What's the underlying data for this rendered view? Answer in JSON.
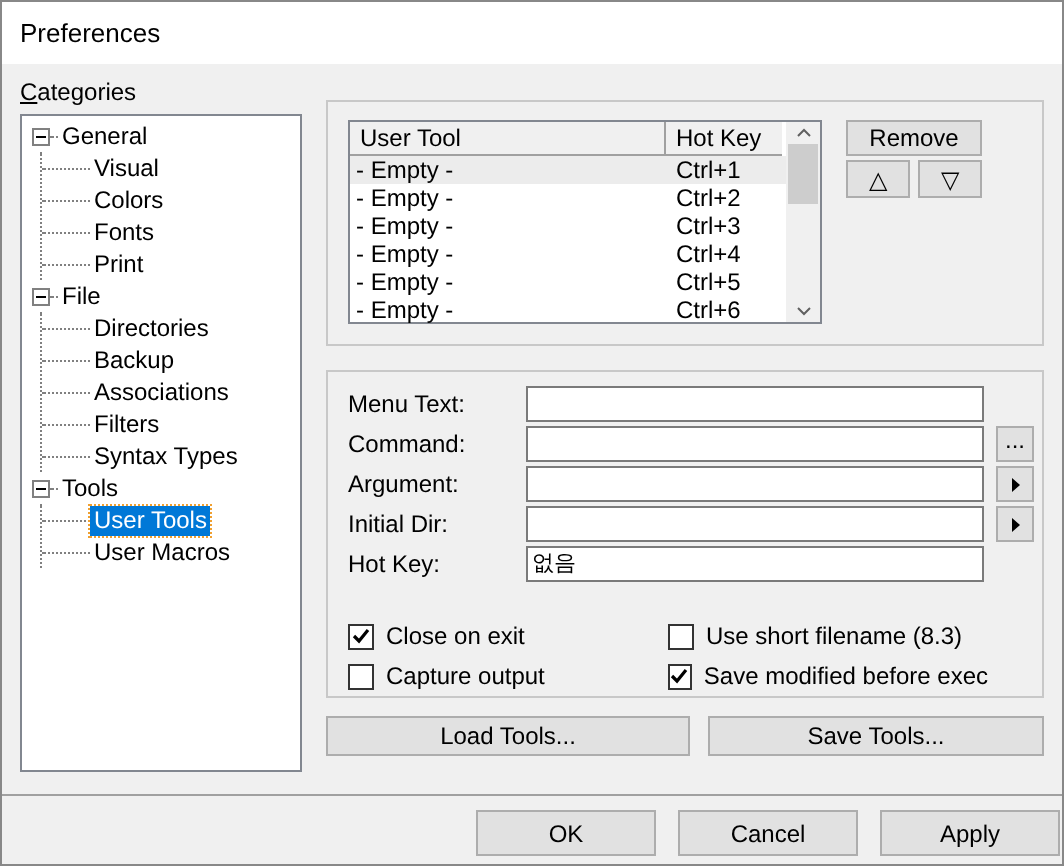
{
  "window": {
    "title": "Preferences"
  },
  "categories_label": "Categories",
  "tree": [
    {
      "label": "General",
      "expanded": true,
      "selected": false,
      "children": [
        {
          "label": "Visual",
          "selected": false
        },
        {
          "label": "Colors",
          "selected": false
        },
        {
          "label": "Fonts",
          "selected": false
        },
        {
          "label": "Print",
          "selected": false
        }
      ]
    },
    {
      "label": "File",
      "expanded": true,
      "selected": false,
      "children": [
        {
          "label": "Directories",
          "selected": false
        },
        {
          "label": "Backup",
          "selected": false
        },
        {
          "label": "Associations",
          "selected": false
        },
        {
          "label": "Filters",
          "selected": false
        },
        {
          "label": "Syntax Types",
          "selected": false
        }
      ]
    },
    {
      "label": "Tools",
      "expanded": true,
      "selected": false,
      "children": [
        {
          "label": "User Tools",
          "selected": true
        },
        {
          "label": "User Macros",
          "selected": false
        }
      ]
    }
  ],
  "tool_list": {
    "columns": [
      "User Tool",
      "Hot Key"
    ],
    "rows": [
      {
        "user_tool": "- Empty -",
        "hot_key": "Ctrl+1",
        "selected": true
      },
      {
        "user_tool": "- Empty -",
        "hot_key": "Ctrl+2",
        "selected": false
      },
      {
        "user_tool": "- Empty -",
        "hot_key": "Ctrl+3",
        "selected": false
      },
      {
        "user_tool": "- Empty -",
        "hot_key": "Ctrl+4",
        "selected": false
      },
      {
        "user_tool": "- Empty -",
        "hot_key": "Ctrl+5",
        "selected": false
      },
      {
        "user_tool": "- Empty -",
        "hot_key": "Ctrl+6",
        "selected": false
      }
    ]
  },
  "remove_button": "Remove",
  "move_up_button": "△",
  "move_down_button": "▽",
  "fields": [
    {
      "label": "Menu Text:",
      "kind": "plain"
    },
    {
      "label": "Command:",
      "kind": "browse",
      "button_text": "..."
    },
    {
      "label": "Argument:",
      "kind": "menu"
    },
    {
      "label": "Initial Dir:",
      "kind": "menu"
    },
    {
      "label": "Hot Key:",
      "kind": "plain",
      "value": "없음"
    }
  ],
  "checkboxes": [
    {
      "label": "Close on exit",
      "checked": true
    },
    {
      "label": "Use short filename (8.3)",
      "checked": false
    },
    {
      "label": "Capture output",
      "checked": false
    },
    {
      "label": "Save modified before exec",
      "checked": true
    }
  ],
  "load_button": "Load Tools...",
  "save_button": "Save Tools...",
  "dialog_buttons": [
    "OK",
    "Cancel",
    "Apply"
  ]
}
